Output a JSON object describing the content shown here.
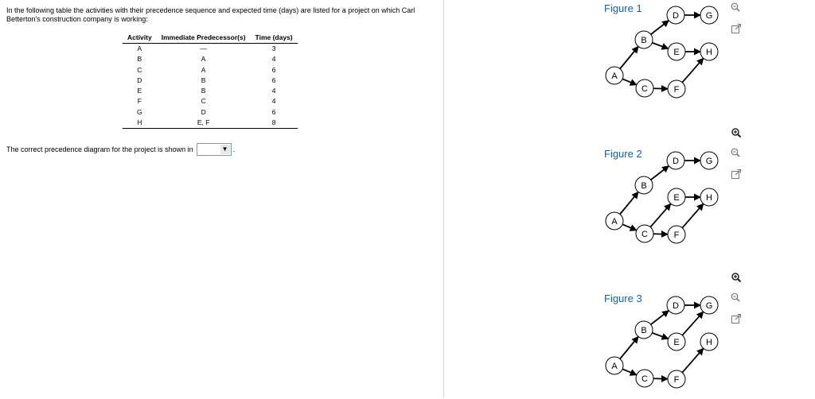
{
  "question": {
    "intro": "In the following table the activities with their precedence sequence and expected time (days) are listed for a project on which Carl Betterton's construction company is working:",
    "table": {
      "headers": [
        "Activity",
        "Immediate Predecessor(s)",
        "Time (days)"
      ],
      "rows": [
        {
          "activity": "A",
          "predecessor": "—",
          "time": "3"
        },
        {
          "activity": "B",
          "predecessor": "A",
          "time": "4"
        },
        {
          "activity": "C",
          "predecessor": "A",
          "time": "6"
        },
        {
          "activity": "D",
          "predecessor": "B",
          "time": "6"
        },
        {
          "activity": "E",
          "predecessor": "B",
          "time": "4"
        },
        {
          "activity": "F",
          "predecessor": "C",
          "time": "4"
        },
        {
          "activity": "G",
          "predecessor": "D",
          "time": "6"
        },
        {
          "activity": "H",
          "predecessor": "E, F",
          "time": "8"
        }
      ]
    },
    "prompt": "The correct precedence diagram for the project is shown in",
    "dropdown_value": "",
    "period": "."
  },
  "figures": [
    {
      "label": "Figure 1",
      "nodes": [
        "A",
        "B",
        "C",
        "D",
        "E",
        "F",
        "G",
        "H"
      ],
      "edges": [
        [
          "A",
          "B"
        ],
        [
          "A",
          "C"
        ],
        [
          "B",
          "D"
        ],
        [
          "B",
          "E"
        ],
        [
          "C",
          "F"
        ],
        [
          "D",
          "G"
        ],
        [
          "E",
          "H"
        ],
        [
          "F",
          "H"
        ]
      ]
    },
    {
      "label": "Figure 2",
      "nodes": [
        "A",
        "B",
        "C",
        "D",
        "E",
        "F",
        "G",
        "H"
      ],
      "edges": [
        [
          "A",
          "B"
        ],
        [
          "A",
          "C"
        ],
        [
          "B",
          "D"
        ],
        [
          "C",
          "E"
        ],
        [
          "C",
          "F"
        ],
        [
          "D",
          "G"
        ],
        [
          "E",
          "H"
        ],
        [
          "F",
          "H"
        ]
      ]
    },
    {
      "label": "Figure 3",
      "nodes": [
        "A",
        "B",
        "C",
        "D",
        "E",
        "F",
        "G",
        "H"
      ],
      "edges": [
        [
          "A",
          "B"
        ],
        [
          "A",
          "C"
        ],
        [
          "B",
          "D"
        ],
        [
          "B",
          "E"
        ],
        [
          "C",
          "F"
        ],
        [
          "D",
          "G"
        ],
        [
          "E",
          "G"
        ],
        [
          "F",
          "H"
        ]
      ]
    }
  ],
  "icons": {
    "zoom_in": "zoom-in-icon",
    "zoom_out": "zoom-out-icon",
    "popout": "external-link-icon"
  },
  "colors": {
    "figure_label": "#1a5fa5",
    "dropdown_border": "#7f9db9"
  }
}
